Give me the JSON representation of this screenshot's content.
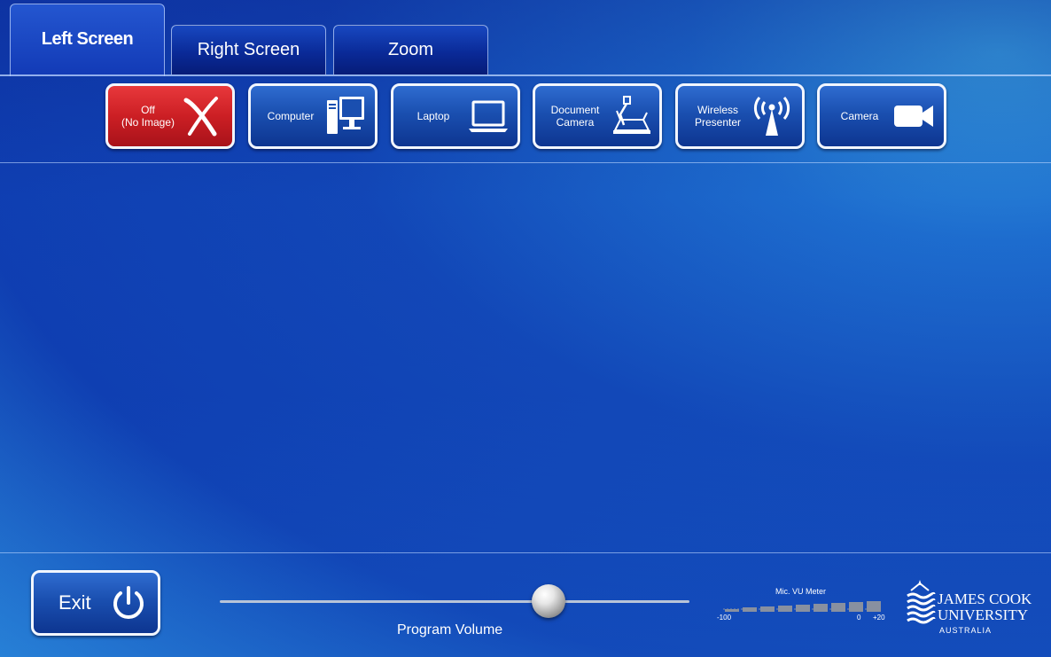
{
  "tabs": [
    {
      "label": "Left Screen",
      "active": true
    },
    {
      "label": "Right Screen",
      "active": false
    },
    {
      "label": "Zoom",
      "active": false
    }
  ],
  "sources": [
    {
      "label": "Off\n(No Image)",
      "icon": "x-icon",
      "selected": true
    },
    {
      "label": "Computer",
      "icon": "desktop-computer-icon",
      "selected": false
    },
    {
      "label": "Laptop",
      "icon": "laptop-icon",
      "selected": false
    },
    {
      "label": "Document\nCamera",
      "icon": "document-camera-icon",
      "selected": false
    },
    {
      "label": "Wireless\nPresenter",
      "icon": "wireless-antenna-icon",
      "selected": false
    },
    {
      "label": "Camera",
      "icon": "video-camera-icon",
      "selected": false
    }
  ],
  "footer": {
    "exit_label": "Exit",
    "volume_label": "Program Volume",
    "volume_level": 0.7,
    "vu_meter": {
      "title": "Mic. VU Meter",
      "ticks": [
        "-100",
        "0",
        "+20"
      ]
    },
    "logo": {
      "line1": "JAMES COOK",
      "line2": "UNIVERSITY",
      "line3": "AUSTRALIA"
    }
  },
  "colors": {
    "selected_red": "#cc1f24",
    "button_blue": "#1a4fb0",
    "border_white": "#f2f6ff"
  }
}
